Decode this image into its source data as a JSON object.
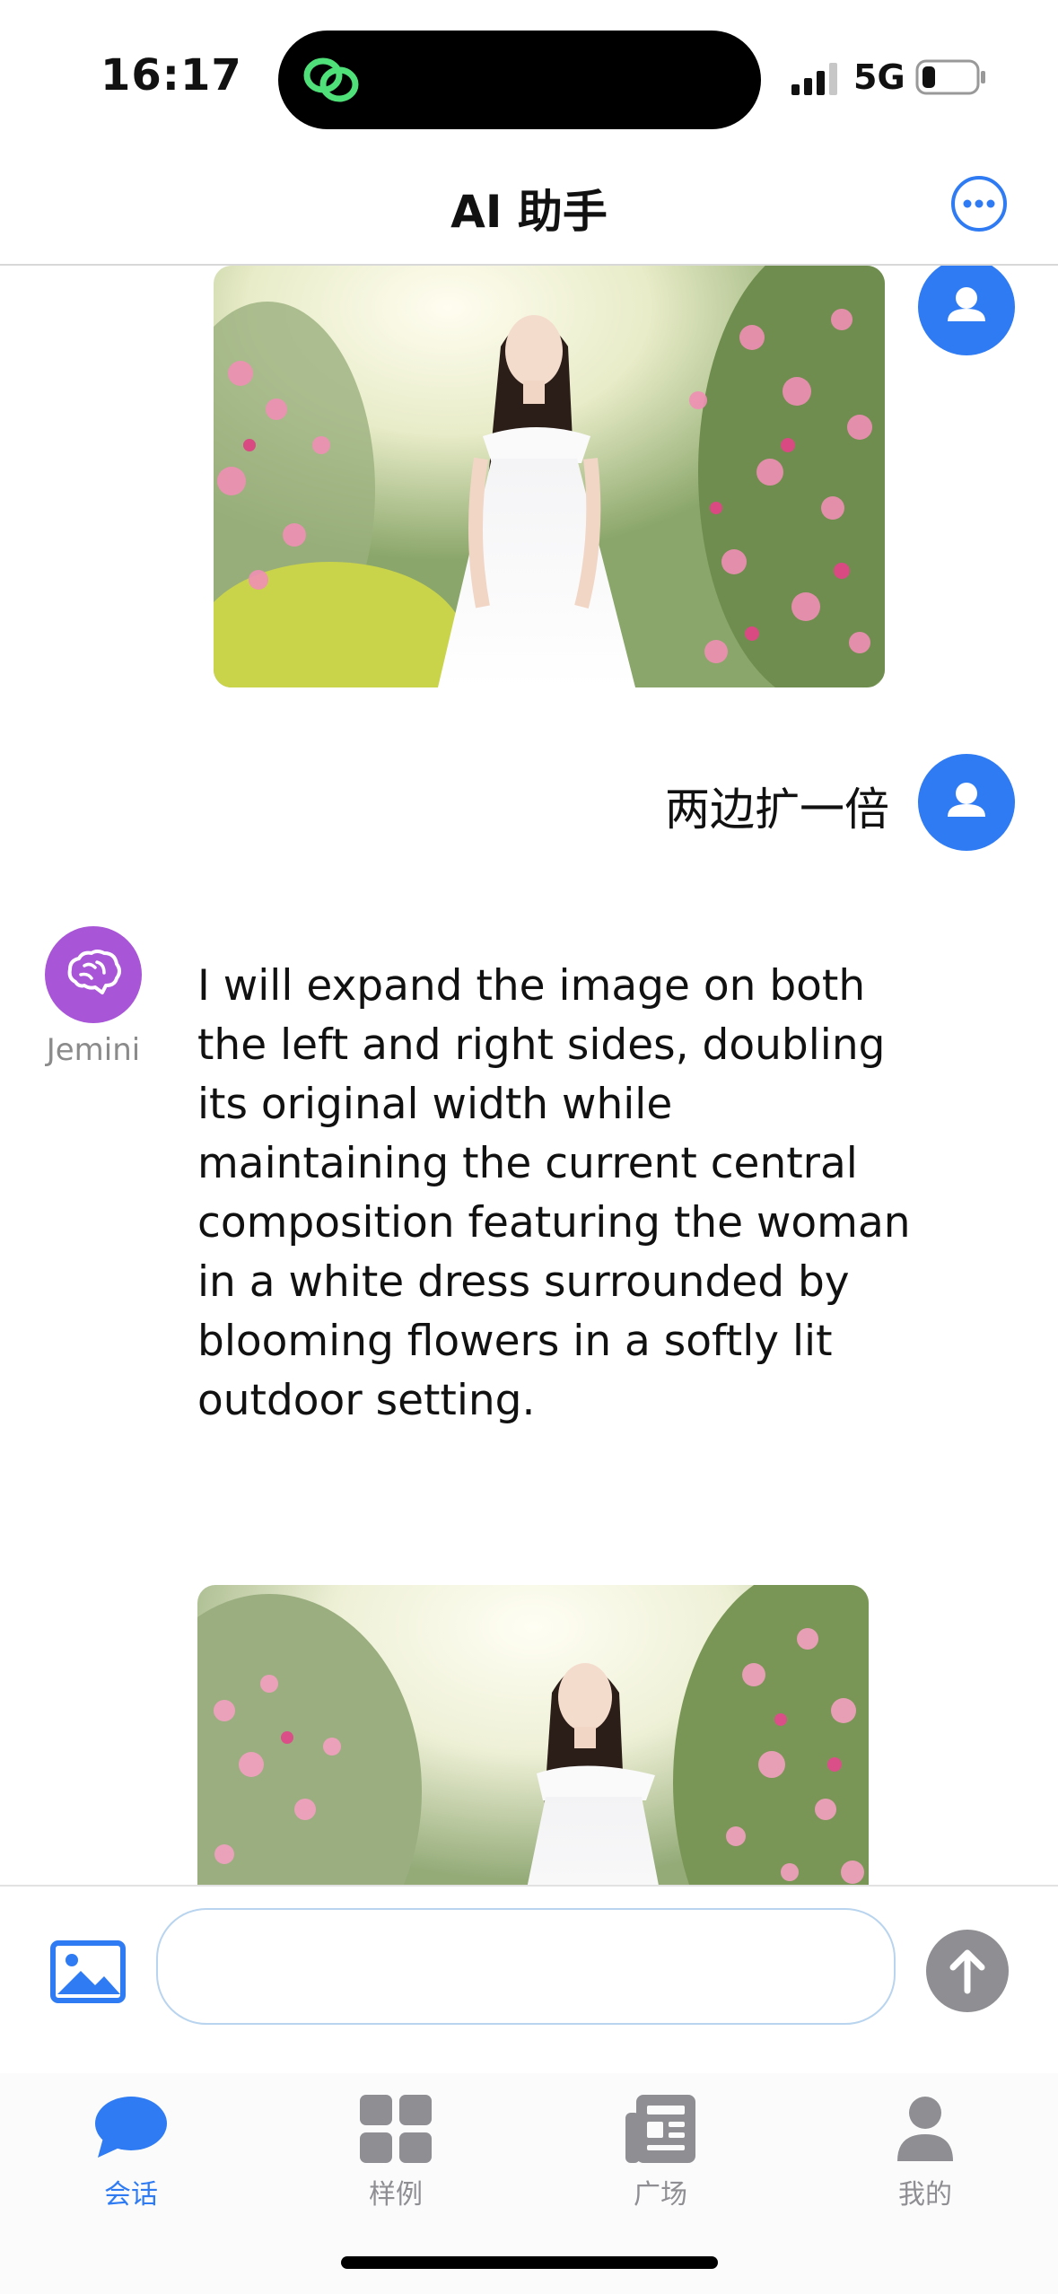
{
  "status_bar": {
    "time": "16:17",
    "network": "5G",
    "icons": [
      "link-icon",
      "signal-icon",
      "battery-icon"
    ]
  },
  "header": {
    "title": "AI 助手",
    "more_icon": "ellipsis-icon"
  },
  "chat": {
    "messages": [
      {
        "role": "user",
        "type": "image",
        "alt": ""
      },
      {
        "role": "user",
        "type": "text",
        "text": "两边扩一倍"
      },
      {
        "role": "assistant",
        "type": "text",
        "sender": "Jemini",
        "text": "I will expand the image on both the left and right sides, doubling its original width while maintaining the current central composition featuring the woman in a white dress surrounded by blooming flowers in a softly lit outdoor setting."
      },
      {
        "role": "assistant",
        "type": "image",
        "alt": ""
      }
    ]
  },
  "input_bar": {
    "value": "",
    "placeholder": "",
    "image_icon": "image-icon",
    "send_icon": "arrow-up-icon"
  },
  "tab_bar": {
    "tabs": [
      {
        "label": "会话",
        "icon": "chat-bubble-icon",
        "active": true
      },
      {
        "label": "样例",
        "icon": "grid-icon",
        "active": false
      },
      {
        "label": "广场",
        "icon": "newspaper-icon",
        "active": false
      },
      {
        "label": "我的",
        "icon": "person-icon",
        "active": false
      }
    ]
  },
  "colors": {
    "accent": "#2f7bf3",
    "assistant_avatar": "#a855d8",
    "send_disabled": "#8e8e93"
  }
}
